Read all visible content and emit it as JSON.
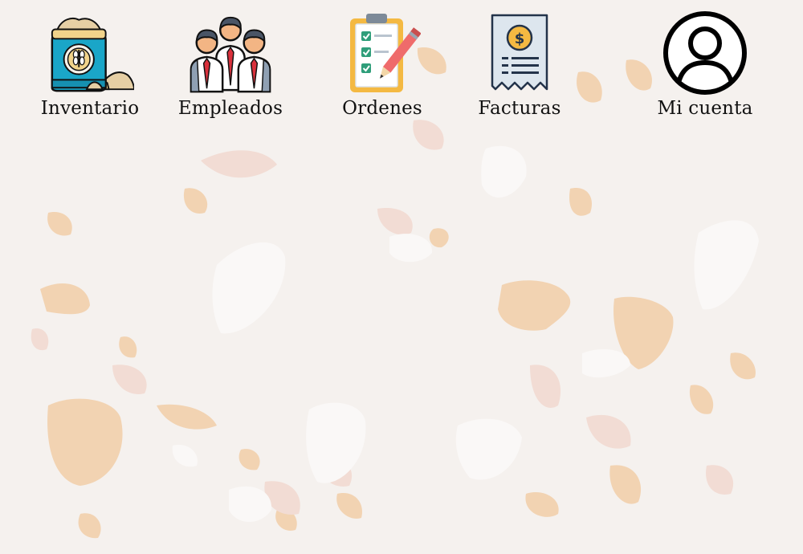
{
  "nav": {
    "items": [
      {
        "label": "Inventario",
        "icon": "grain-sack-icon"
      },
      {
        "label": "Empleados",
        "icon": "employees-icon"
      },
      {
        "label": "Ordenes",
        "icon": "clipboard-checklist-icon"
      },
      {
        "label": "Facturas",
        "icon": "invoice-receipt-icon"
      },
      {
        "label": "Mi cuenta",
        "icon": "user-account-icon"
      }
    ]
  },
  "colors": {
    "background": "#f5f1ee",
    "terrazzo_peach": "#f2d3b2",
    "terrazzo_pink": "#f2dcd4",
    "terrazzo_white": "#faf8f7",
    "label_text": "#111111"
  }
}
